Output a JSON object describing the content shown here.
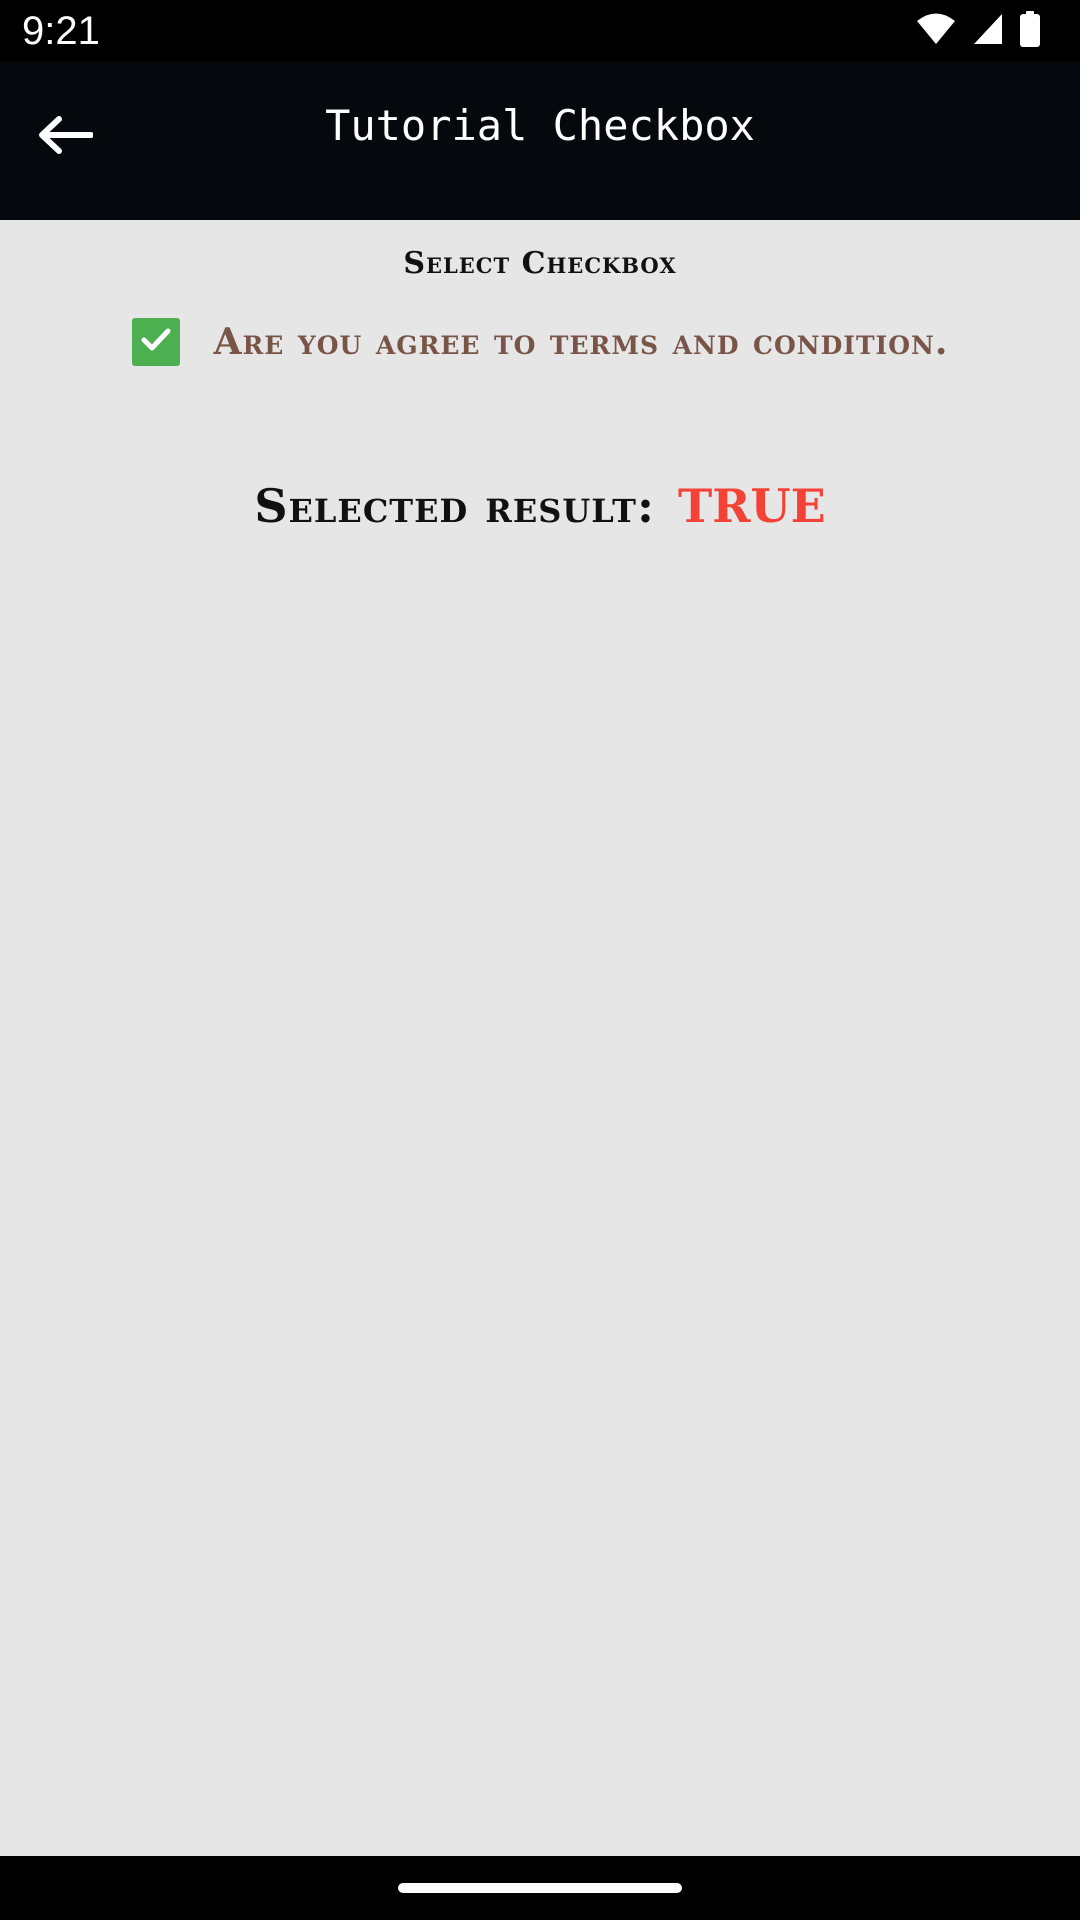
{
  "status_bar": {
    "time": "9:21",
    "icons": [
      "wifi-icon",
      "cell-signal-icon",
      "battery-icon"
    ]
  },
  "app_bar": {
    "back_icon": "arrow-left-icon",
    "title": "Tutorial Checkbox"
  },
  "content": {
    "heading": "Select Checkbox",
    "checkbox": {
      "checked": true,
      "label": "Are you agree to terms and condition.",
      "color": "#4caf50"
    },
    "result": {
      "label": "Selected result:",
      "value": "TRUE",
      "value_color": "#f44336"
    }
  },
  "colors": {
    "app_bar_bg": "#05080c",
    "content_bg": "#e6e6e6",
    "label_brown": "#795548"
  }
}
